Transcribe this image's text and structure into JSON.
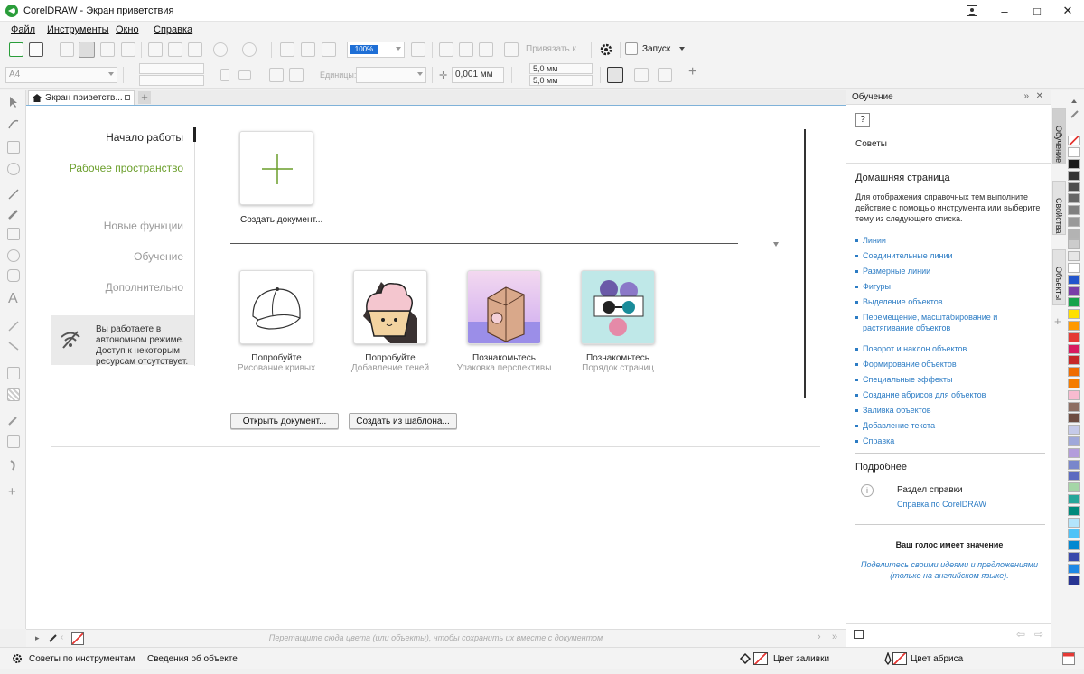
{
  "window": {
    "title": "CorelDRAW - Экран приветствия"
  },
  "menu": [
    "Файл",
    "Инструменты",
    "Окно",
    "Справка"
  ],
  "toolbar": {
    "snap_label": "Привязать к",
    "launch_label": "Запуск",
    "zoom_value": "100%"
  },
  "propbar": {
    "page_size": "A4",
    "units_label": "Единицы:",
    "nudge_value": "0,001 мм",
    "dup_x": "5,0 мм",
    "dup_y": "5,0 мм"
  },
  "tab": {
    "label": "Экран приветств..."
  },
  "welcome": {
    "nav": [
      "Начало работы",
      "Рабочее пространство",
      "Новые функции",
      "Обучение",
      "Дополнительно"
    ],
    "offline_text": "Вы работаете в автономном режиме. Доступ к некоторым ресурсам отсутствует.",
    "new_doc_label": "Создать документ...",
    "cards": [
      {
        "title": "Попробуйте",
        "subtitle": "Рисование кривых"
      },
      {
        "title": "Попробуйте",
        "subtitle": "Добавление теней"
      },
      {
        "title": "Познакомьтесь",
        "subtitle": "Упаковка перспективы"
      },
      {
        "title": "Познакомьтесь",
        "subtitle": "Порядок страниц"
      }
    ],
    "open_doc_button": "Открыть документ...",
    "from_template_button": "Создать из шаблона..."
  },
  "learning": {
    "panel_title": "Обучение",
    "tips_label": "Советы",
    "home_title": "Домашняя страница",
    "home_desc": "Для отображения справочных тем выполните действие с помощью инструмента или выберите тему из следующего списка.",
    "links": [
      "Линии",
      "Соединительные линии",
      "Размерные линии",
      "Фигуры",
      "Выделение объектов",
      "Перемещение, масштабирование и растягивание объектов",
      "Поворот и наклон объектов",
      "Формирование объектов",
      "Специальные эффекты",
      "Создание абрисов для объектов",
      "Заливка объектов",
      "Добавление текста",
      "Справка"
    ],
    "more_title": "Подробнее",
    "help_section": "Раздел справки",
    "help_link": "Справка по CorelDRAW",
    "feedback_title": "Ваш голос имеет значение",
    "feedback_text": "Поделитесь своими идеями и предложениями (только на английском языке)."
  },
  "dockers": [
    "Обучение",
    "Свойства",
    "Объекты"
  ],
  "doc_palette_hint": "Перетащите сюда цвета (или объекты), чтобы сохранить их вместе с документом",
  "status": {
    "hints": "Советы по инструментам",
    "object_info": "Сведения об объекте",
    "fill": "Цвет заливки",
    "outline": "Цвет абриса"
  },
  "palette_colors": [
    "#ffffff",
    "#1a1a1a",
    "#333333",
    "#4d4d4d",
    "#666666",
    "#808080",
    "#999999",
    "#b3b3b3",
    "#cccccc",
    "#e6e6e6",
    "#ffffff",
    "#2255cc",
    "#7a3ea8",
    "#16a34a",
    "#ffe000",
    "#ff9900",
    "#e53935",
    "#d81b60",
    "#c62828",
    "#ef6c00",
    "#f57c00",
    "#f8bbd0",
    "#8d6e63",
    "#6d4c41",
    "#c5cae9",
    "#9fa8da",
    "#b39ddb",
    "#7986cb",
    "#5c6bc0",
    "#a5d6a7",
    "#26a69a",
    "#00897b",
    "#b3e5fc",
    "#4fc3f7",
    "#0288d1",
    "#3949ab",
    "#1e88e5",
    "#283593"
  ]
}
